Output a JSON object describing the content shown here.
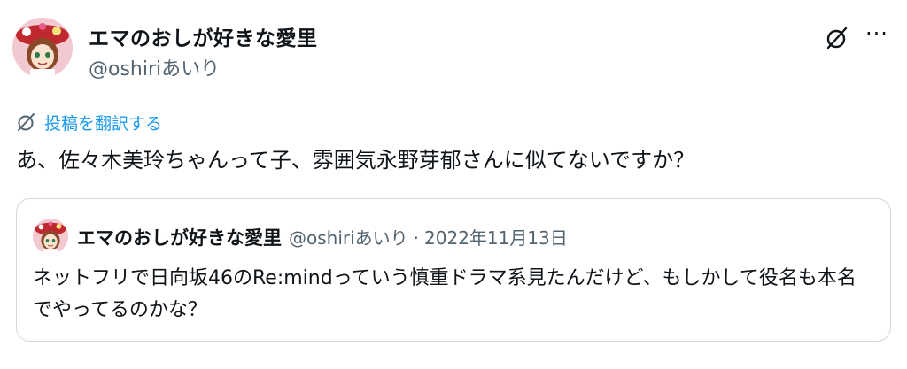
{
  "author": {
    "display_name": "エマのおしが好きな愛里",
    "handle": "@oshiriあいり",
    "avatar": "avatar-girl-with-red-hat"
  },
  "actions": {
    "grok_icon": "grok-slash-icon",
    "more_label": "···"
  },
  "translate": {
    "icon": "grok-translate-icon",
    "label": "投稿を翻訳する"
  },
  "tweet": {
    "text": "あ、佐々木美玲ちゃんって子、雰囲気永野芽郁さんに似てないですか？"
  },
  "quote": {
    "display_name": "エマのおしが好きな愛里",
    "handle": "@oshiriあいり",
    "separator": "·",
    "date": "2022年11月13日",
    "text": "ネットフリで日向坂46のRe:mindっていう慎重ドラマ系見たんだけど、もしかして役名も本名でやってるのかな？"
  },
  "colors": {
    "link_blue": "#1d9bf0",
    "secondary_text": "#536471",
    "border": "#cfd9de"
  }
}
